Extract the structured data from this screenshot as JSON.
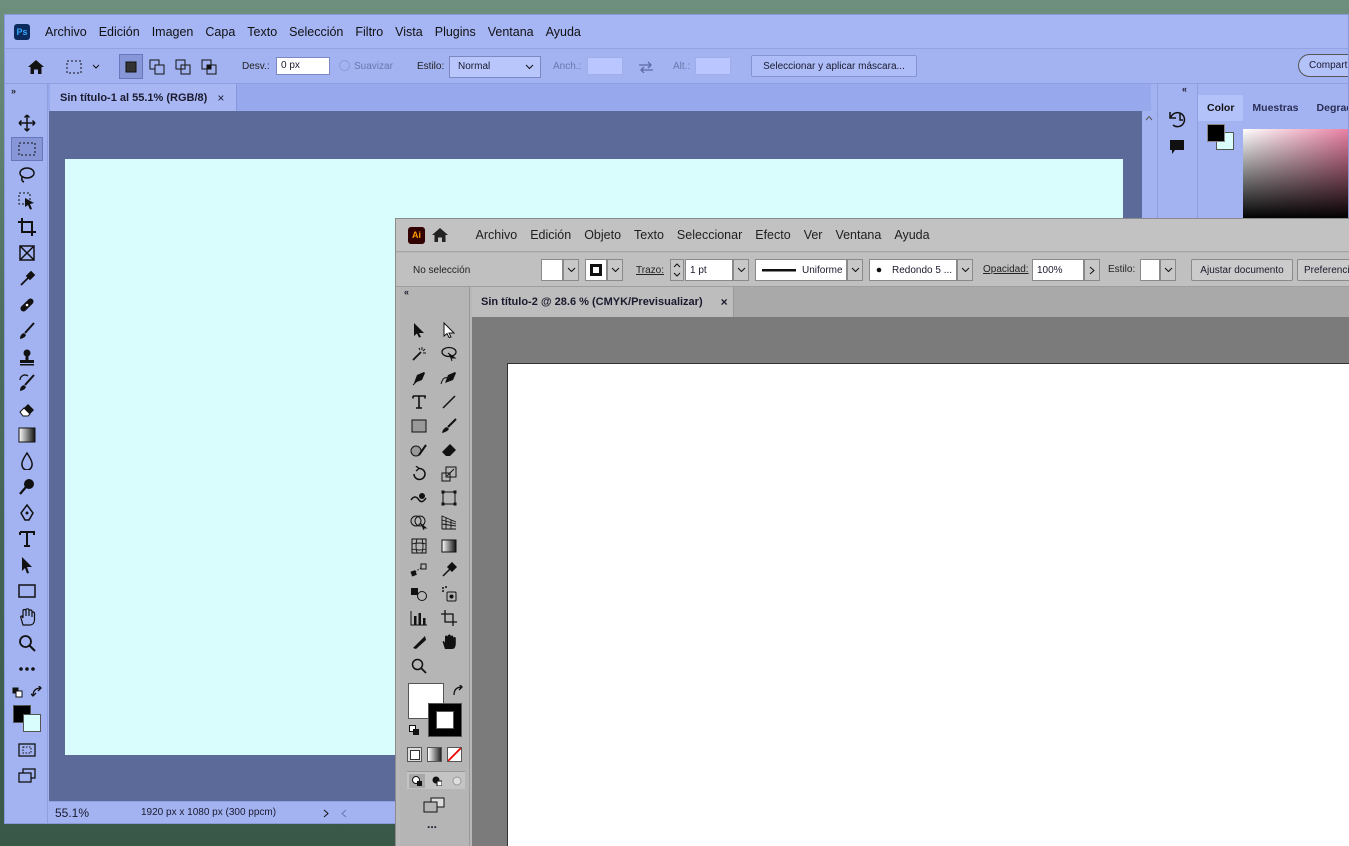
{
  "photoshop": {
    "logo": "Ps",
    "menu": [
      "Archivo",
      "Edición",
      "Imagen",
      "Capa",
      "Texto",
      "Selección",
      "Filtro",
      "Vista",
      "Plugins",
      "Ventana",
      "Ayuda"
    ],
    "options": {
      "feather_label": "Desv.:",
      "feather_value": "0 px",
      "antialias_label": "Suavizar",
      "style_label": "Estilo:",
      "style_value": "Normal",
      "width_label": "Anch.:",
      "height_label": "Alt.:",
      "select_mask_button": "Seleccionar y aplicar máscara...",
      "share_button": "Compartir"
    },
    "document_tab": "Sin título-1 al 55.1% (RGB/8)",
    "tab_close": "×",
    "status": {
      "zoom": "55.1%",
      "doc_info": "1920 px x 1080 px (300 ppcm)"
    },
    "panel_tabs": [
      "Color",
      "Muestras",
      "Degradados"
    ],
    "colors": {
      "foreground": "#000000",
      "background": "#d9fdfd"
    }
  },
  "illustrator": {
    "logo": "Ai",
    "menu": [
      "Archivo",
      "Edición",
      "Objeto",
      "Texto",
      "Seleccionar",
      "Efecto",
      "Ver",
      "Ventana",
      "Ayuda"
    ],
    "control": {
      "selection_status": "No selección",
      "stroke_label": "Trazo:",
      "stroke_weight": "1 pt",
      "stroke_profile": "Uniforme",
      "brush": "Redondo 5 ...",
      "opacity_label": "Opacidad:",
      "opacity_value": "100%",
      "style_label": "Estilo:",
      "fit_document_button": "Ajustar documento",
      "preferences_button": "Preferencias"
    },
    "document_tab": "Sin título-2 @ 28.6 % (CMYK/Previsualizar)",
    "tab_close": "×",
    "more_tools": "..."
  }
}
